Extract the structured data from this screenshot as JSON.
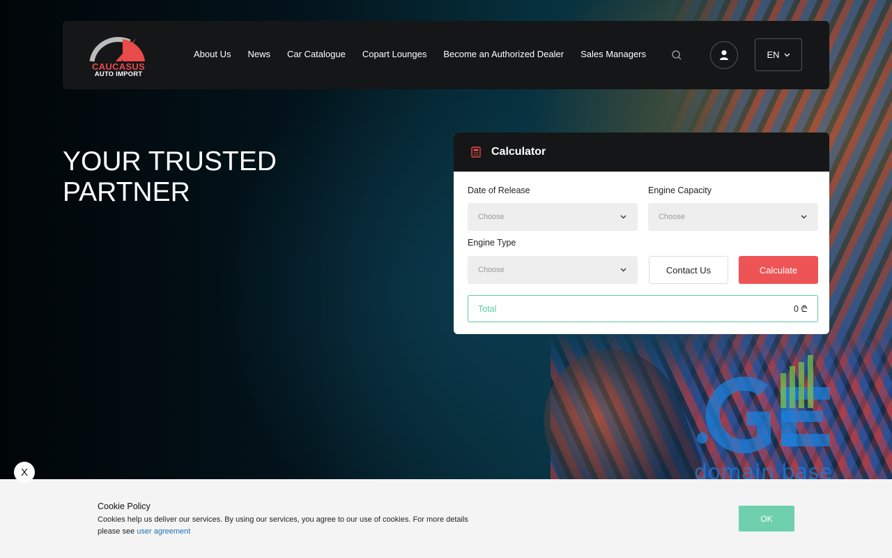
{
  "brand": {
    "name_line1": "CAUCASUS",
    "name_line2": "AUTO IMPORT",
    "accent_color": "#e94b4b"
  },
  "nav": {
    "items": [
      {
        "label": "About Us"
      },
      {
        "label": "News"
      },
      {
        "label": "Car Catalogue"
      },
      {
        "label": "Copart Lounges"
      },
      {
        "label": "Become an Authorized Dealer"
      },
      {
        "label": "Sales Managers"
      }
    ],
    "search_icon": "search-icon",
    "user_icon": "user-icon",
    "language": "EN"
  },
  "hero": {
    "title": "YOUR TRUSTED PARTNER"
  },
  "calculator": {
    "title": "Calculator",
    "icon": "calculator-icon",
    "fields": {
      "date_of_release": {
        "label": "Date of Release",
        "value": "Choose"
      },
      "engine_capacity": {
        "label": "Engine Capacity",
        "value": "Choose"
      },
      "engine_type": {
        "label": "Engine Type",
        "value": "Choose"
      }
    },
    "contact_label": "Contact Us",
    "calculate_label": "Calculate",
    "total_label": "Total",
    "total_value": "0 ₾",
    "calculate_color": "#ee5455",
    "total_color": "#5cc9a3"
  },
  "watermark": {
    "text": "domain base"
  },
  "close_label": "X",
  "cookie": {
    "title": "Cookie Policy",
    "text": "Cookies help us deliver our services. By using our services, you agree to our use of cookies. For more details please see",
    "link_label": "user agreement",
    "ok_label": "OK",
    "ok_color": "#6fd0ad"
  }
}
